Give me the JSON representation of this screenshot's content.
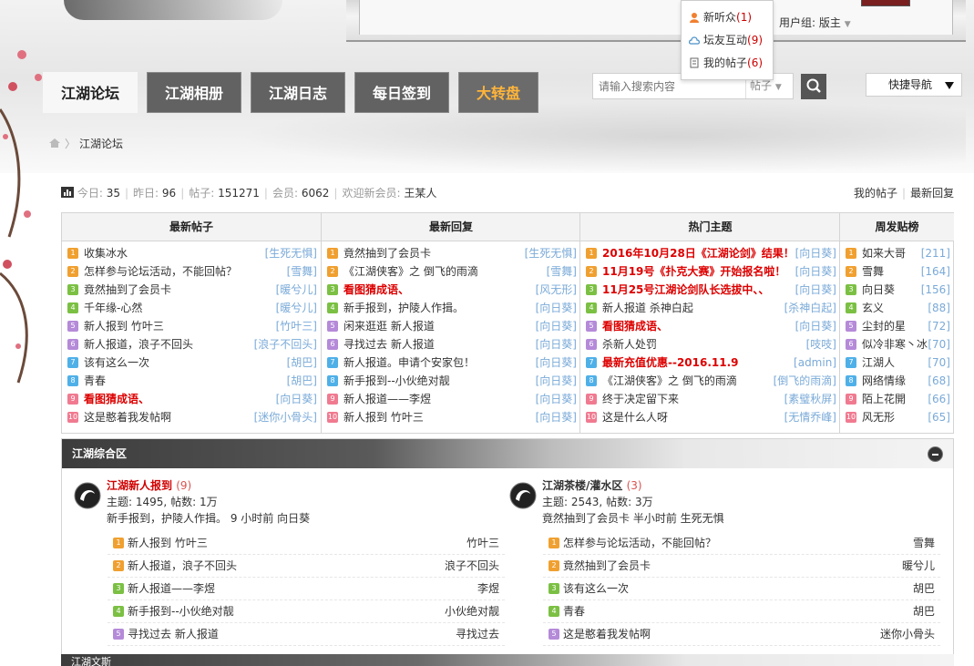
{
  "header": {
    "user_group_label": "用户组: 版主",
    "dropdown_items": [
      {
        "label": "新听众",
        "count": "(1)",
        "icon": "user-icon"
      },
      {
        "label": "坛友互动",
        "count": "(9)",
        "icon": "cloud-icon"
      },
      {
        "label": "我的帖子",
        "count": "(6)",
        "icon": "document-icon"
      }
    ]
  },
  "nav": {
    "tabs": [
      "江湖论坛",
      "江湖相册",
      "江湖日志",
      "每日签到",
      "大转盘"
    ]
  },
  "search": {
    "placeholder": "请输入搜索内容",
    "type_label": "帖子",
    "button_icon": "search-icon"
  },
  "quick_nav_label": "快捷导航",
  "breadcrumb": {
    "home_icon": "home-icon",
    "current": "江湖论坛"
  },
  "stats": {
    "today_label": "今日:",
    "today": "35",
    "yesterday_label": "昨日:",
    "yesterday": "96",
    "posts_label": "帖子:",
    "posts": "151271",
    "members_label": "会员:",
    "members": "6062",
    "welcome_label": "欢迎新会员:",
    "welcome_user": "王某人",
    "my_posts": "我的帖子",
    "latest_replies": "最新回复"
  },
  "colors": {
    "num_1": "#f0a030",
    "num_2": "#f0a030",
    "num_3": "#7bc043",
    "num_4": "#7bc043",
    "num_5": "#b58ad8",
    "num_6": "#b58ad8",
    "num_7": "#4fb0e8",
    "num_8": "#4fb0e8",
    "num_9": "#f07a90",
    "num_10": "#f07a90",
    "link_author": "#7aaad8",
    "hot_red": "#d00000",
    "nav_hot": "#ffb43a"
  },
  "top_columns": [
    {
      "title": "最新帖子",
      "rows": [
        {
          "n": "1",
          "t": "收集冰水",
          "a": "[生死无惧]",
          "red": false
        },
        {
          "n": "2",
          "t": "怎样参与论坛活动，不能回帖？",
          "a": "[雪舞]",
          "red": false
        },
        {
          "n": "3",
          "t": "竟然抽到了会员卡",
          "a": "[暖兮儿]",
          "red": false
        },
        {
          "n": "4",
          "t": "千年缘-心然",
          "a": "[暖兮儿]",
          "red": false
        },
        {
          "n": "5",
          "t": "新人报到 竹叶三",
          "a": "[竹叶三]",
          "red": false
        },
        {
          "n": "6",
          "t": "新人报道，浪子不回头",
          "a": "[浪子不回头]",
          "red": false
        },
        {
          "n": "7",
          "t": "该有这么一次",
          "a": "[胡巴]",
          "red": false
        },
        {
          "n": "8",
          "t": "青春",
          "a": "[胡巴]",
          "red": false
        },
        {
          "n": "9",
          "t": "看图猜成语、",
          "a": "[向日葵]",
          "red": true
        },
        {
          "n": "10",
          "t": "这是憨着我发帖啊",
          "a": "[迷你小骨头]",
          "red": false
        }
      ]
    },
    {
      "title": "最新回复",
      "rows": [
        {
          "n": "1",
          "t": "竟然抽到了会员卡",
          "a": "[生死无惧]",
          "red": false
        },
        {
          "n": "2",
          "t": "《江湖侠客》之 倒飞的雨滴",
          "a": "[雪舞]",
          "red": false
        },
        {
          "n": "3",
          "t": "看图猜成语、",
          "a": "[风无形]",
          "red": true
        },
        {
          "n": "4",
          "t": "新手报到，护陵人作揖。",
          "a": "[向日葵]",
          "red": false
        },
        {
          "n": "5",
          "t": "闲来逛逛 新人报道",
          "a": "[向日葵]",
          "red": false
        },
        {
          "n": "6",
          "t": "寻找过去 新人报道",
          "a": "[向日葵]",
          "red": false
        },
        {
          "n": "7",
          "t": "新人报道。申请个安家包！",
          "a": "[向日葵]",
          "red": false
        },
        {
          "n": "8",
          "t": "新手报到--小伙绝对靓",
          "a": "[向日葵]",
          "red": false
        },
        {
          "n": "9",
          "t": "新人报道——李煜",
          "a": "[向日葵]",
          "red": false
        },
        {
          "n": "10",
          "t": "新人报到 竹叶三",
          "a": "[向日葵]",
          "red": false
        }
      ]
    },
    {
      "title": "热门主题",
      "rows": [
        {
          "n": "1",
          "t": "2016年10月28日《江湖论剑》结果！",
          "a": "[向日葵]",
          "red": true
        },
        {
          "n": "2",
          "t": "11月19号《扑克大赛》开始报名啦！",
          "a": "[向日葵]",
          "red": true
        },
        {
          "n": "3",
          "t": "11月25号江湖论剑队长选拔中、、",
          "a": "[向日葵]",
          "red": true
        },
        {
          "n": "4",
          "t": "新人报道 杀神白起",
          "a": "[杀神白起]",
          "red": false
        },
        {
          "n": "5",
          "t": "看图猜成语、",
          "a": "[向日葵]",
          "red": true
        },
        {
          "n": "6",
          "t": "杀新人处罚",
          "a": "[吱吱]",
          "red": false
        },
        {
          "n": "7",
          "t": "最新充值优惠--2016.11.9",
          "a": "[admin]",
          "red": true
        },
        {
          "n": "8",
          "t": "《江湖侠客》之 倒飞的雨滴",
          "a": "[倒飞的雨滴]",
          "red": false
        },
        {
          "n": "9",
          "t": "终于决定留下来",
          "a": "[素璧秋屏]",
          "red": false
        },
        {
          "n": "10",
          "t": "这是什么人呀",
          "a": "[无情乔峰]",
          "red": false
        }
      ]
    },
    {
      "title": "周发贴榜",
      "rows": [
        {
          "n": "1",
          "t": "如来大哥",
          "a": "[211]",
          "red": false
        },
        {
          "n": "2",
          "t": "雪舞",
          "a": "[164]",
          "red": false
        },
        {
          "n": "3",
          "t": "向日葵",
          "a": "[156]",
          "red": false
        },
        {
          "n": "4",
          "t": "玄义",
          "a": "[88]",
          "red": false
        },
        {
          "n": "5",
          "t": "尘封的星",
          "a": "[72]",
          "red": false
        },
        {
          "n": "6",
          "t": "似冷非寒丶冰",
          "a": "[70]",
          "red": false
        },
        {
          "n": "7",
          "t": "江湖人",
          "a": "[70]",
          "red": false
        },
        {
          "n": "8",
          "t": "网络情缘",
          "a": "[68]",
          "red": false
        },
        {
          "n": "9",
          "t": "陌上花開",
          "a": "[66]",
          "red": false
        },
        {
          "n": "10",
          "t": "风无形",
          "a": "[65]",
          "red": false
        }
      ]
    }
  ],
  "section": {
    "title": "江湖综合区",
    "forums": [
      {
        "name": "江湖新人报到",
        "count": "(9)",
        "name_color": "#d00000",
        "topics_label": "主题:",
        "topics": "1495",
        "posts_label": "帖数:",
        "posts": "1万",
        "last": "新手报到，护陵人作揖。 9 小时前 向日葵",
        "threads": [
          {
            "n": "1",
            "t": "新人报到 竹叶三",
            "a": "竹叶三"
          },
          {
            "n": "2",
            "t": "新人报道，浪子不回头",
            "a": "浪子不回头"
          },
          {
            "n": "3",
            "t": "新人报道——李煜",
            "a": "李煜"
          },
          {
            "n": "4",
            "t": "新手报到--小伙绝对靓",
            "a": "小伙绝对靓"
          },
          {
            "n": "5",
            "t": "寻找过去 新人报道",
            "a": "寻找过去"
          }
        ]
      },
      {
        "name": "江湖茶楼/灌水区",
        "count": "(3)",
        "name_color": "#333333",
        "topics_label": "主题:",
        "topics": "2543",
        "posts_label": "帖数:",
        "posts": "3万",
        "last": "竟然抽到了会员卡 半小时前 生死无惧",
        "threads": [
          {
            "n": "1",
            "t": "怎样参与论坛活动，不能回帖？",
            "a": "雪舞"
          },
          {
            "n": "2",
            "t": "竟然抽到了会员卡",
            "a": "暖兮儿"
          },
          {
            "n": "3",
            "t": "该有这么一次",
            "a": "胡巴"
          },
          {
            "n": "4",
            "t": "青春",
            "a": "胡巴"
          },
          {
            "n": "5",
            "t": "这是憨着我发帖啊",
            "a": "迷你小骨头"
          }
        ]
      }
    ]
  },
  "next_section_title": "江湖文斯"
}
